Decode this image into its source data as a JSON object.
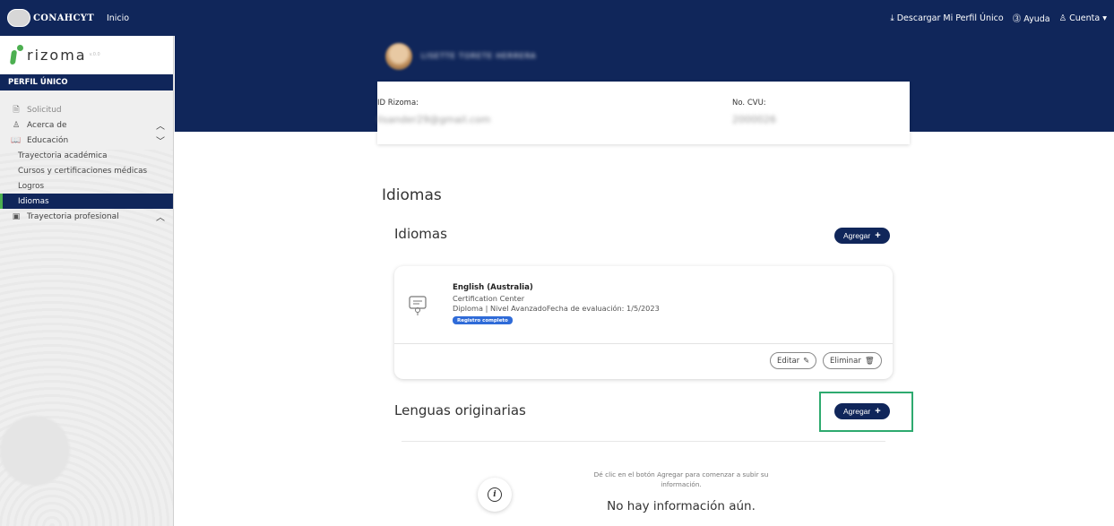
{
  "topbar": {
    "brand": "CONAHCYT",
    "inicio": "Inicio",
    "download": "Descargar Mi Perfil Único",
    "help": "Ayuda",
    "account": "Cuenta"
  },
  "sidebar": {
    "logo_text": "rizoma",
    "logo_small": "v.0.0",
    "header": "PERFIL ÚNICO",
    "items": [
      {
        "label": "Solicitud",
        "icon": "document-icon"
      },
      {
        "label": "Acerca de",
        "icon": "person-icon"
      },
      {
        "label": "Educación",
        "icon": "book-icon"
      },
      {
        "label": "Trayectoria profesional",
        "icon": "badge-icon"
      }
    ],
    "sub_items": [
      {
        "label": "Trayectoria académica"
      },
      {
        "label": "Cursos y certificaciones médicas"
      },
      {
        "label": "Logros"
      },
      {
        "label": "Idiomas"
      }
    ]
  },
  "profile": {
    "name": "LISETTE TORETE HERRERA",
    "id_label": "ID Rizoma:",
    "id_value": "lisander29@gmail.com",
    "cvu_label": "No. CVU:",
    "cvu_value": "2000026"
  },
  "main": {
    "title": "Idiomas",
    "idiomas_subtitle": "Idiomas",
    "add_label": "Agregar",
    "language": {
      "name": "English (Australia)",
      "center": "Certification Center",
      "detail": "Diploma | Nivel AvanzadoFecha de evaluación: 1/5/2023",
      "badge": "Registro completo",
      "edit": "Editar",
      "delete": "Eliminar"
    },
    "lenguas_subtitle": "Lenguas originarias",
    "empty_hint": "Dé clic en el botón Agregar para comenzar a subir su información.",
    "empty_title": "No hay información aún."
  }
}
